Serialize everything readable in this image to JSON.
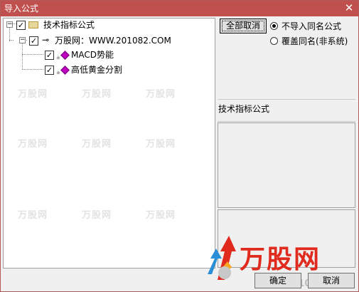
{
  "window": {
    "title": "导入公式",
    "close_glyph": "✕"
  },
  "tree": {
    "root": {
      "label": "技术指标公式",
      "checked": true,
      "expander": "−"
    },
    "child": {
      "label": "万股网：WWW.201082.COM",
      "checked": true,
      "expander": "−",
      "icon": "key-icon"
    },
    "items": [
      {
        "label": "MACD势能",
        "checked": true,
        "icon": "diamond-icon"
      },
      {
        "label": "高低黄金分割",
        "checked": true,
        "icon": "diamond-icon"
      }
    ],
    "watermark": "万股网"
  },
  "right_panel": {
    "uncheck_all_label": "全部取消",
    "radio_options": [
      {
        "label": "不导入同名公式",
        "selected": true
      },
      {
        "label": "覆盖同名(非系统)",
        "selected": false
      }
    ],
    "section_title": "技术指标公式"
  },
  "footer": {
    "ok_label": "确定",
    "cancel_label": "取消"
  },
  "logo": {
    "text": "万股网",
    "url": "www.201082.com",
    "color": "#e02a1e"
  },
  "colors": {
    "titlebar": "#c0504d",
    "accent": "#e02a1e"
  }
}
